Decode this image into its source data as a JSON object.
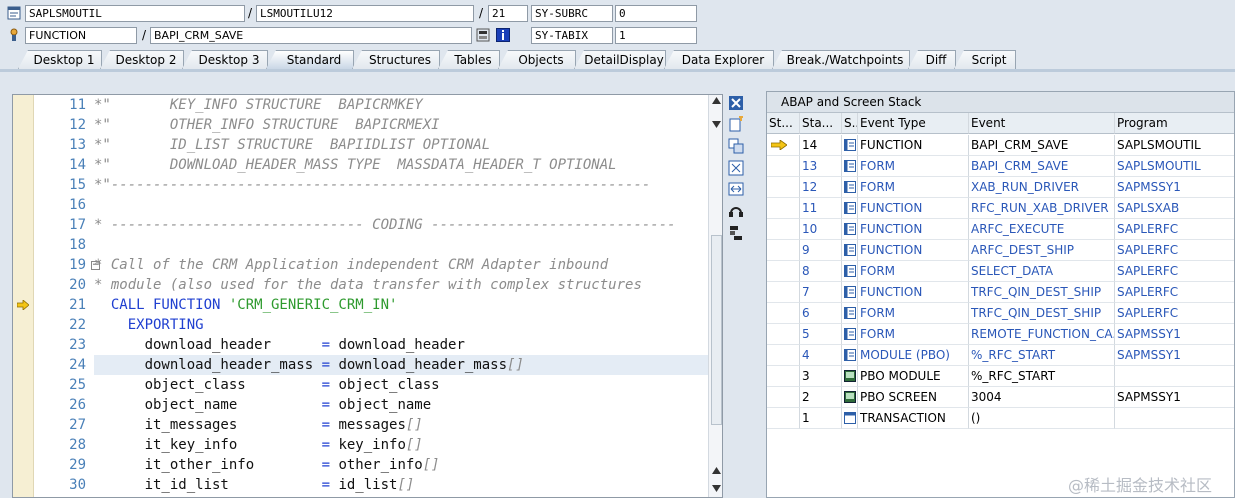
{
  "header": {
    "program": "SAPLSMOUTIL",
    "include": "LSMOUTILU12",
    "line": "21",
    "field1_name": "SY-SUBRC",
    "field1_value": "0",
    "event_type": "FUNCTION",
    "event": "BAPI_CRM_SAVE",
    "field2_name": "SY-TABIX",
    "field2_value": "1",
    "sep": "/"
  },
  "tabs": [
    {
      "label": "Desktop 1"
    },
    {
      "label": "Desktop 2"
    },
    {
      "label": "Desktop 3"
    },
    {
      "label": "Standard"
    },
    {
      "label": "Structures"
    },
    {
      "label": "Tables"
    },
    {
      "label": "Objects"
    },
    {
      "label": "DetailDisplay"
    },
    {
      "label": "Data Explorer"
    },
    {
      "label": "Break./Watchpoints"
    },
    {
      "label": "Diff"
    },
    {
      "label": "Script"
    }
  ],
  "active_tab": "Standard",
  "editor": {
    "current_line": "21",
    "lines": [
      {
        "num": "11",
        "parts": [
          {
            "t": "*\"       KEY_INFO STRUCTURE  BAPICRMKEY",
            "c": "comment"
          }
        ]
      },
      {
        "num": "12",
        "parts": [
          {
            "t": "*\"       OTHER_INFO STRUCTURE  BAPICRMEXI",
            "c": "comment"
          }
        ]
      },
      {
        "num": "13",
        "parts": [
          {
            "t": "*\"       ID_LIST STRUCTURE  BAPIIDLIST OPTIONAL",
            "c": "comment"
          }
        ]
      },
      {
        "num": "14",
        "parts": [
          {
            "t": "*\"       DOWNLOAD_HEADER_MASS TYPE  MASSDATA_HEADER_T OPTIONAL",
            "c": "comment"
          }
        ]
      },
      {
        "num": "15",
        "parts": [
          {
            "t": "*\"----------------------------------------------------------------",
            "c": "comment"
          }
        ]
      },
      {
        "num": "16",
        "parts": [
          {
            "t": "",
            "c": "plain"
          }
        ]
      },
      {
        "num": "17",
        "parts": [
          {
            "t": "* ------------------------------ CODING -----------------------------",
            "c": "comment"
          }
        ]
      },
      {
        "num": "18",
        "parts": [
          {
            "t": "",
            "c": "plain"
          }
        ]
      },
      {
        "num": "19",
        "parts": [
          {
            "t": "* Call of the CRM Application independent CRM Adapter inbound",
            "c": "comment"
          }
        ]
      },
      {
        "num": "20",
        "parts": [
          {
            "t": "* module (also used for the data transfer with complex structures",
            "c": "comment"
          }
        ]
      },
      {
        "num": "21",
        "parts": [
          {
            "t": "  CALL FUNCTION ",
            "c": "kw"
          },
          {
            "t": "'CRM_GENERIC_CRM_IN'",
            "c": "str"
          }
        ]
      },
      {
        "num": "22",
        "parts": [
          {
            "t": "    EXPORTING",
            "c": "kw"
          }
        ]
      },
      {
        "num": "23",
        "parts": [
          {
            "t": "      download_header      ",
            "c": "plain"
          },
          {
            "t": "= ",
            "c": "kw"
          },
          {
            "t": "download_header",
            "c": "plain"
          }
        ]
      },
      {
        "num": "24",
        "parts": [
          {
            "t": "      download_header_mass ",
            "c": "plain"
          },
          {
            "t": "= ",
            "c": "kw"
          },
          {
            "t": "download_header_mass",
            "c": "plain"
          },
          {
            "t": "[]",
            "c": "comment"
          }
        ]
      },
      {
        "num": "25",
        "parts": [
          {
            "t": "      object_class         ",
            "c": "plain"
          },
          {
            "t": "= ",
            "c": "kw"
          },
          {
            "t": "object_class",
            "c": "plain"
          }
        ]
      },
      {
        "num": "26",
        "parts": [
          {
            "t": "      object_name          ",
            "c": "plain"
          },
          {
            "t": "= ",
            "c": "kw"
          },
          {
            "t": "object_name",
            "c": "plain"
          }
        ]
      },
      {
        "num": "27",
        "parts": [
          {
            "t": "      it_messages          ",
            "c": "plain"
          },
          {
            "t": "= ",
            "c": "kw"
          },
          {
            "t": "messages",
            "c": "plain"
          },
          {
            "t": "[]",
            "c": "comment"
          }
        ]
      },
      {
        "num": "28",
        "parts": [
          {
            "t": "      it_key_info          ",
            "c": "plain"
          },
          {
            "t": "= ",
            "c": "kw"
          },
          {
            "t": "key_info",
            "c": "plain"
          },
          {
            "t": "[]",
            "c": "comment"
          }
        ]
      },
      {
        "num": "29",
        "parts": [
          {
            "t": "      it_other_info        ",
            "c": "plain"
          },
          {
            "t": "= ",
            "c": "kw"
          },
          {
            "t": "other_info",
            "c": "plain"
          },
          {
            "t": "[]",
            "c": "comment"
          }
        ]
      },
      {
        "num": "30",
        "parts": [
          {
            "t": "      it_id_list           ",
            "c": "plain"
          },
          {
            "t": "= ",
            "c": "kw"
          },
          {
            "t": "id_list",
            "c": "plain"
          },
          {
            "t": "[]",
            "c": "comment"
          }
        ]
      }
    ]
  },
  "stack": {
    "title": "ABAP and Screen Stack",
    "columns": [
      "St...",
      "Sta...",
      "S...",
      "Event Type",
      "Event",
      "Program"
    ],
    "rows": [
      {
        "st": "",
        "level": "14",
        "icon": "function-module-icon",
        "type": "FUNCTION",
        "event": "BAPI_CRM_SAVE",
        "program": "SAPLSMOUTIL",
        "current": true,
        "blue": false
      },
      {
        "st": "",
        "level": "13",
        "icon": "function-module-icon",
        "type": "FORM",
        "event": "BAPI_CRM_SAVE",
        "program": "SAPLSMOUTIL",
        "current": false,
        "blue": true
      },
      {
        "st": "",
        "level": "12",
        "icon": "function-module-icon",
        "type": "FORM",
        "event": "XAB_RUN_DRIVER",
        "program": "SAPMSSY1",
        "current": false,
        "blue": true
      },
      {
        "st": "",
        "level": "11",
        "icon": "function-module-icon",
        "type": "FUNCTION",
        "event": "RFC_RUN_XAB_DRIVER",
        "program": "SAPLSXAB",
        "current": false,
        "blue": true
      },
      {
        "st": "",
        "level": "10",
        "icon": "function-module-icon",
        "type": "FUNCTION",
        "event": "ARFC_EXECUTE",
        "program": "SAPLERFC",
        "current": false,
        "blue": true
      },
      {
        "st": "",
        "level": "9",
        "icon": "function-module-icon",
        "type": "FUNCTION",
        "event": "ARFC_DEST_SHIP",
        "program": "SAPLERFC",
        "current": false,
        "blue": true
      },
      {
        "st": "",
        "level": "8",
        "icon": "function-module-icon",
        "type": "FORM",
        "event": "SELECT_DATA",
        "program": "SAPLERFC",
        "current": false,
        "blue": true
      },
      {
        "st": "",
        "level": "7",
        "icon": "function-module-icon",
        "type": "FUNCTION",
        "event": "TRFC_QIN_DEST_SHIP",
        "program": "SAPLERFC",
        "current": false,
        "blue": true
      },
      {
        "st": "",
        "level": "6",
        "icon": "function-module-icon",
        "type": "FORM",
        "event": "TRFC_QIN_DEST_SHIP",
        "program": "SAPLERFC",
        "current": false,
        "blue": true
      },
      {
        "st": "",
        "level": "5",
        "icon": "function-module-icon",
        "type": "FORM",
        "event": "REMOTE_FUNCTION_CA...",
        "program": "SAPMSSY1",
        "current": false,
        "blue": true
      },
      {
        "st": "",
        "level": "4",
        "icon": "function-module-icon",
        "type": "MODULE (PBO)",
        "event": "%_RFC_START",
        "program": "SAPMSSY1",
        "current": false,
        "blue": true
      },
      {
        "st": "",
        "level": "3",
        "icon": "screen-icon",
        "type": "PBO MODULE",
        "event": "%_RFC_START",
        "program": "",
        "current": false,
        "blue": false
      },
      {
        "st": "",
        "level": "2",
        "icon": "screen-icon",
        "type": "PBO SCREEN",
        "event": "3004",
        "program": "SAPMSSY1",
        "current": false,
        "blue": false
      },
      {
        "st": "",
        "level": "1",
        "icon": "transaction-icon",
        "type": "TRANSACTION",
        "event": "()",
        "program": "",
        "current": false,
        "blue": false
      }
    ]
  },
  "watermark": "@稀土掘金技术社区",
  "colors": {
    "link_blue": "#2a57b8",
    "comment": "#8c8c8c",
    "keyword": "#1f3fd0",
    "string": "#2e9a2e",
    "line_number": "#4a80b8"
  }
}
